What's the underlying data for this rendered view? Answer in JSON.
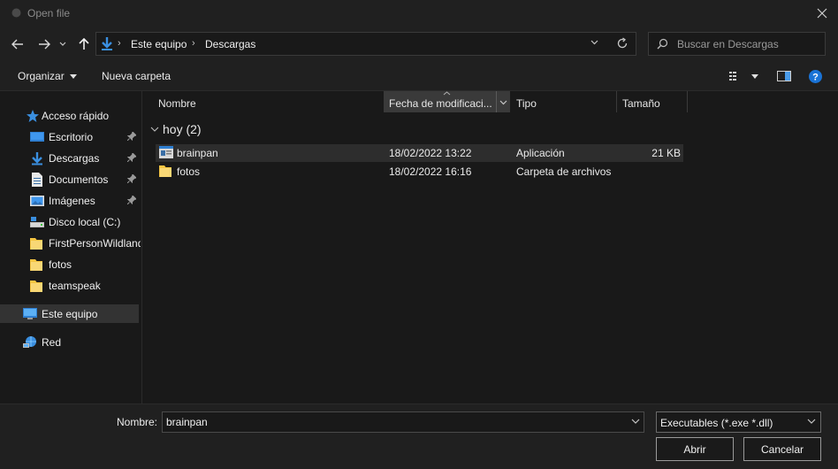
{
  "window": {
    "title": "Open file"
  },
  "address": {
    "crumbs": [
      "Este equipo",
      "Descargas"
    ]
  },
  "search": {
    "placeholder": "Buscar en Descargas"
  },
  "toolbar": {
    "organize_label": "Organizar",
    "new_folder_label": "Nueva carpeta"
  },
  "nav": {
    "items": [
      {
        "label": "Acceso rápido",
        "icon": "star-icon"
      },
      {
        "label": "Escritorio",
        "icon": "desktop-icon",
        "pinned": true
      },
      {
        "label": "Descargas",
        "icon": "download-icon",
        "pinned": true
      },
      {
        "label": "Documentos",
        "icon": "document-icon",
        "pinned": true
      },
      {
        "label": "Imágenes",
        "icon": "pictures-icon",
        "pinned": true
      },
      {
        "label": "Disco local (C:)",
        "icon": "drive-icon"
      },
      {
        "label": "FirstPersonWildland",
        "icon": "folder-icon"
      },
      {
        "label": "fotos",
        "icon": "folder-icon"
      },
      {
        "label": "teamspeak",
        "icon": "folder-icon"
      },
      {
        "label": "Este equipo",
        "icon": "computer-icon",
        "selected": true
      },
      {
        "label": "Red",
        "icon": "network-icon"
      }
    ]
  },
  "columns": {
    "name": "Nombre",
    "modified": "Fecha de modificaci...",
    "type": "Tipo",
    "size": "Tamaño"
  },
  "group": {
    "label": "hoy (2)"
  },
  "files": [
    {
      "name": "brainpan",
      "modified": "18/02/2022 13:22",
      "type": "Aplicación",
      "size": "21 KB",
      "icon": "application-icon"
    },
    {
      "name": "fotos",
      "modified": "18/02/2022 16:16",
      "type": "Carpeta de archivos",
      "size": "",
      "icon": "folder-icon"
    }
  ],
  "bottom": {
    "filename_label": "Nombre:",
    "filename_value": "brainpan",
    "filetype_value": "Executables (*.exe *.dll)",
    "open_label": "Abrir",
    "cancel_label": "Cancelar"
  },
  "colors": {
    "accent": "#0078d7",
    "folder": "#f5c542",
    "background": "#191919",
    "chrome": "#202020"
  }
}
